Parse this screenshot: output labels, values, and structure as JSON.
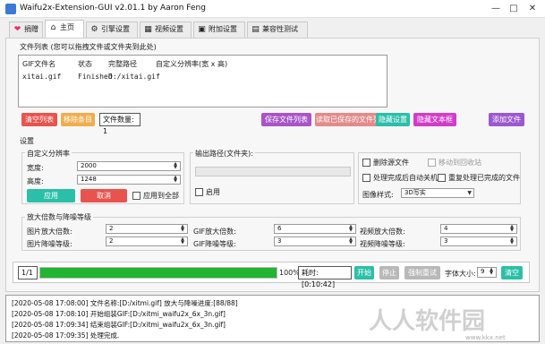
{
  "window": {
    "title": "Waifu2x-Extension-GUI v2.01.1 by Aaron Feng",
    "controls": [
      "—",
      "□",
      "✕"
    ]
  },
  "tabs": [
    {
      "label": "捐赠",
      "icon": "heart-icon",
      "glyph": "❤"
    },
    {
      "label": "主页",
      "icon": "home-icon",
      "glyph": "⌂"
    },
    {
      "label": "引擎设置",
      "icon": "engine-icon",
      "glyph": "⚙"
    },
    {
      "label": "视频设置",
      "icon": "clapperboard-icon",
      "glyph": "▦"
    },
    {
      "label": "附加设置",
      "icon": "addon-icon",
      "glyph": "▣"
    },
    {
      "label": "兼容性测试",
      "icon": "compat-icon",
      "glyph": "▤"
    }
  ],
  "filelist": {
    "title": "文件列表 (您可以拖拽文件或文件夹到此处)",
    "columns": [
      "GIF文件名",
      "状态",
      "完整路径",
      "自定义分辨率(宽 x 高)"
    ],
    "rows": [
      {
        "name": "xitai.gif",
        "status": "Finished",
        "path": "D:/xitai.gif",
        "res": ""
      }
    ]
  },
  "filebuttons": {
    "clear": "清空列表",
    "remove": "移除条目",
    "count": "文件数量: 1",
    "save": "保存文件列表",
    "load": "读取已保存的文件列表",
    "hide_settings": "隐藏设置",
    "hide_textbox": "隐藏文本框",
    "add_files": "添加文件"
  },
  "settings": {
    "title": "设置",
    "custom_res": {
      "title": "自定义分辨率",
      "width_label": "宽度:",
      "width_value": "2000",
      "height_label": "高度:",
      "height_value": "1248",
      "apply": "应用",
      "cancel": "取消",
      "apply_all": "应用到全部"
    },
    "output_path": {
      "title": "输出路径(文件夹):",
      "enable": "启用"
    },
    "options": {
      "delete_original": "删除源文件",
      "move_recycle": "移动到回收站",
      "shutdown": "处理完成后自动关机",
      "reprocess": "重复处理已完成的文件",
      "image_style_label": "图像样式:",
      "image_style_value": "3D写实"
    },
    "scale": {
      "title": "放大倍数与降噪等级",
      "image_scale_label": "图片放大倍数:",
      "image_scale_value": "2",
      "image_denoise_label": "图片降噪等级:",
      "image_denoise_value": "2",
      "gif_scale_label": "GIF放大倍数:",
      "gif_scale_value": "6",
      "gif_denoise_label": "GIF降噪等级:",
      "gif_denoise_value": "3",
      "video_scale_label": "视频放大倍数:",
      "video_scale_value": "4",
      "video_denoise_label": "视频降噪等级:",
      "video_denoise_value": "3"
    }
  },
  "progress": {
    "counter": "1/1",
    "percent_text": "100%",
    "value": 1.0,
    "elapsed": "耗时:[0:10:42]",
    "start": "开始",
    "stop": "停止",
    "force_retry": "强制重试",
    "font_size_label": "字体大小:",
    "font_size_value": "9",
    "clear": "清空"
  },
  "log": [
    "[2020-05-08 17:08:00] 文件名称:[D:/xitmi.gif] 放大与降噪进度:[88/88]",
    "[2020-05-08 17:08:10] 开始组装GIF:[D:/xitmi_waifu2x_6x_3n.gif]",
    "[2020-05-08 17:09:34] 结束组装GIF:[D:/xitmi_waifu2x_6x_3n.gif]",
    "[2020-05-08 17:09:35] 处理完成."
  ],
  "watermark": {
    "text": "人人软件园",
    "url": "www.kkx.net"
  },
  "colors": {
    "progress": "#21b531",
    "red": "#e9534d",
    "teal": "#2bbfa8"
  }
}
